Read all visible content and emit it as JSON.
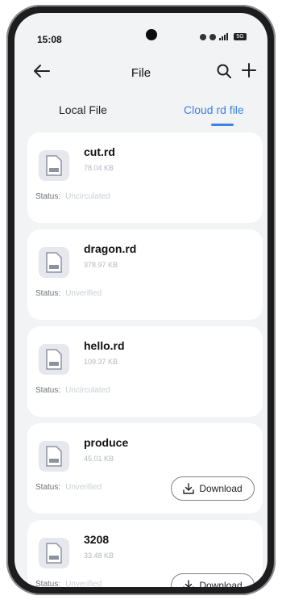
{
  "statusbar": {
    "time": "15:08",
    "battery": "5G"
  },
  "topbar": {
    "title": "File"
  },
  "tabs": [
    {
      "label": "Local File"
    },
    {
      "label": "Cloud rd file"
    }
  ],
  "files": [
    {
      "name": "cut.rd",
      "size": "78.04 KB",
      "status_label": "Status:",
      "status_value": "Uncirculated"
    },
    {
      "name": "dragon.rd",
      "size": "378.97 KB",
      "status_label": "Status:",
      "status_value": "Unverified"
    },
    {
      "name": "hello.rd",
      "size": "109.37 KB",
      "status_label": "Status:",
      "status_value": "Uncirculated"
    },
    {
      "name": "produce",
      "size": "45.01 KB",
      "status_label": "Status:",
      "status_value": "Unverified",
      "download_label": "Download"
    },
    {
      "name": "3208",
      "size": "33.48 KB",
      "status_label": "Status:",
      "status_value": "Unverified",
      "download_label": "Download"
    }
  ],
  "colors": {
    "accent": "#3b82e6",
    "background": "#f2f3f5",
    "card": "#ffffff"
  }
}
